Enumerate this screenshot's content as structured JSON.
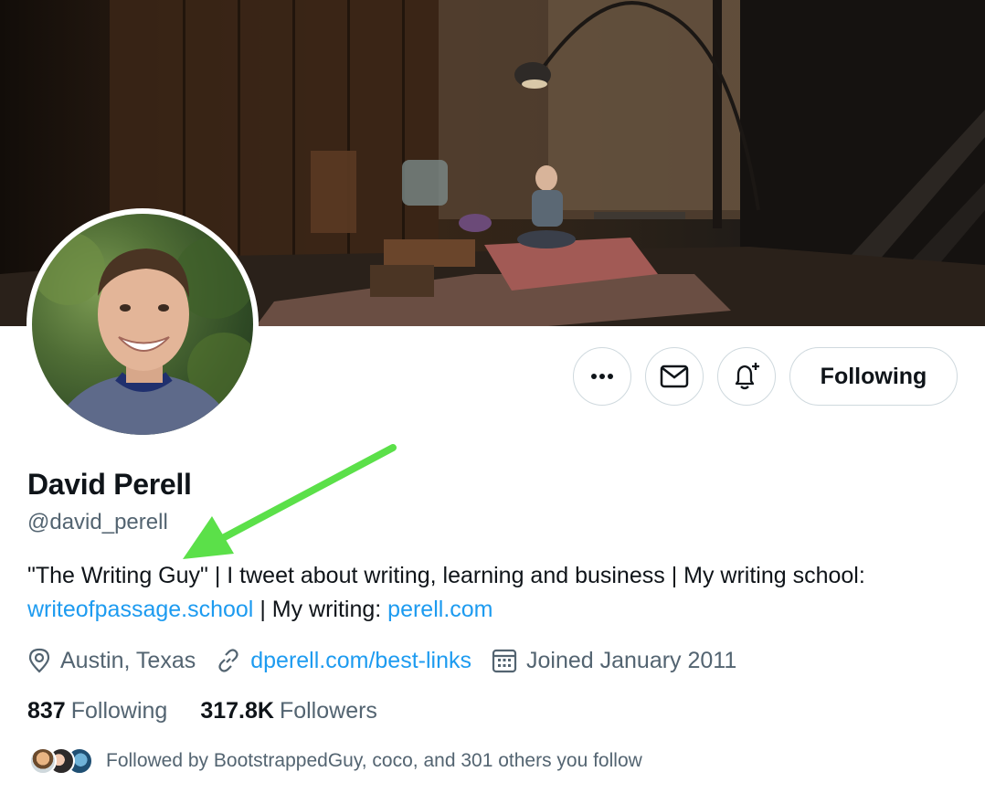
{
  "profile": {
    "display_name": "David Perell",
    "handle": "@david_perell",
    "bio": {
      "line1": "\"The Writing Guy\" | I tweet about writing, learning and business | My writing school:",
      "link1": "writeofpassage.school",
      "mid": " | My writing: ",
      "link2": "perell.com"
    },
    "location": "Austin, Texas",
    "website": "dperell.com/best-links",
    "joined": "Joined January 2011"
  },
  "counts": {
    "following_num": "837",
    "following_label": "Following",
    "followers_num": "317.8K",
    "followers_label": "Followers"
  },
  "actions": {
    "following_button": "Following"
  },
  "followed_by": "Followed by BootstrappedGuy, coco, and 301 others you follow",
  "icons": {
    "more": "more-icon",
    "message": "mail-icon",
    "notify": "bell-plus-icon",
    "location": "location-pin-icon",
    "link": "link-icon",
    "calendar": "calendar-icon"
  },
  "colors": {
    "link": "#1d9bf0",
    "secondary_text": "#536471",
    "annotation_arrow": "#5be049"
  }
}
